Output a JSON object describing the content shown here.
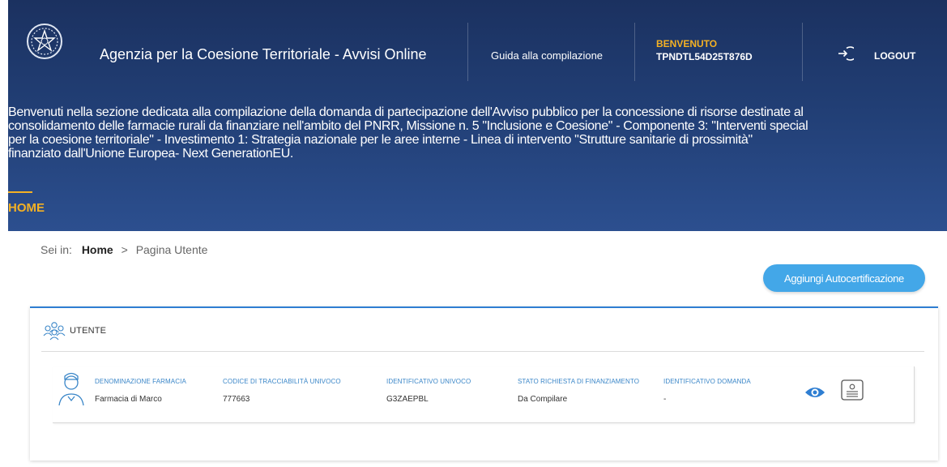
{
  "header": {
    "site_title": "Agenzia per la Coesione Territoriale - Avvisi Online",
    "guide_link": "Guida alla compilazione",
    "welcome_label": "BENVENUTO",
    "welcome_user": "TPNDTL54D25T876D",
    "logout_label": "LOGOUT",
    "intro_text": "Benvenuti nella sezione dedicata alla compilazione della domanda di partecipazione dell'Avviso pubblico per la concessione di risorse destinate al\nconsolidamento delle farmacie rurali da finanziare nell'ambito del PNRR, Missione n. 5 \"Inclusione e Coesione\" - Componente 3: \"Interventi special\nper la coesione territoriale\" - Investimento 1: Strategia nazionale per le aree interne - Linea di intervento \"Strutture sanitarie di prossimità\"\nfinanziato dall'Unione Europea- Next GenerationEU.",
    "nav_home": "HOME"
  },
  "breadcrumb": {
    "prefix": "Sei in:",
    "home": "Home",
    "separator": ">",
    "current": "Pagina Utente"
  },
  "actions": {
    "add_button": "Aggiungi Autocertificazione"
  },
  "card": {
    "title": "UTENTE",
    "row": {
      "columns": [
        {
          "label": "DENOMINAZIONE FARMACIA",
          "value": "Farmacia di Marco"
        },
        {
          "label": "CODICE DI TRACCIABILITÀ UNIVOCO",
          "value": "777663"
        },
        {
          "label": "IDENTIFICATIVO UNIVOCO",
          "value": "G3ZAEPBL"
        },
        {
          "label": "STATO RICHIESTA DI FINANZIAMENTO",
          "value": "Da Compilare"
        },
        {
          "label": "IDENTIFICATIVO DOMANDA",
          "value": "-"
        }
      ]
    }
  },
  "icons": {
    "emblem": "italian-republic-emblem-icon",
    "logout": "logout-icon",
    "users": "users-icon",
    "pharmacist": "pharmacist-icon",
    "view": "eye-icon",
    "document": "document-icon"
  },
  "colors": {
    "header_bg": "#213e74",
    "accent_yellow": "#f4b124",
    "primary_blue": "#2e7ed2",
    "button_blue": "#43a7e8",
    "label_blue": "#3a86c8"
  }
}
